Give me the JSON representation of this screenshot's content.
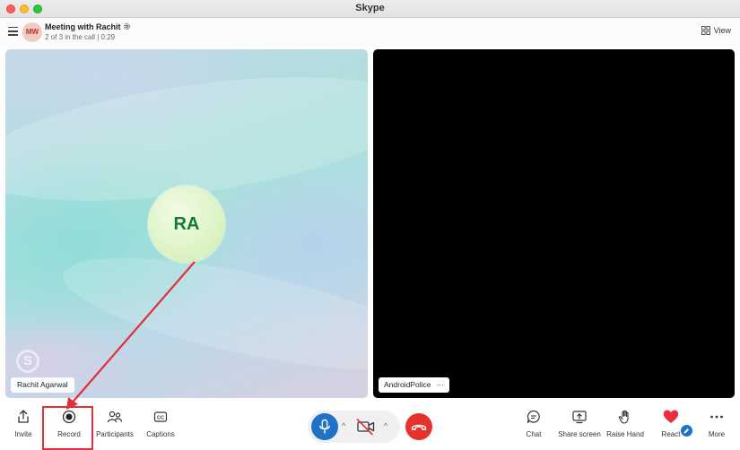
{
  "window": {
    "title": "Skype"
  },
  "header": {
    "avatar_initials": "MW",
    "meeting_title": "Meeting with Rachit",
    "call_status": "2 of 3 in the call | 0:29",
    "view_label": "View"
  },
  "tiles": {
    "left": {
      "initials": "RA",
      "name": "Rachit Agarwal"
    },
    "right": {
      "name": "AndroidPolice",
      "more": "···"
    }
  },
  "toolbar": {
    "invite": "Invite",
    "record": "Record",
    "participants": "Participants",
    "captions": "Captions",
    "chat": "Chat",
    "share_screen": "Share screen",
    "raise_hand": "Raise Hand",
    "react": "React",
    "more": "More"
  },
  "colors": {
    "accent_blue": "#1e72c8",
    "hangup_red": "#e5322d",
    "annotation_red": "#e0303a",
    "react_heart": "#e8303a"
  },
  "icons": {
    "menu": "hamburger-icon",
    "settings": "gear-icon",
    "view": "grid-icon",
    "invite": "share-up-icon",
    "record": "record-icon",
    "participants": "people-icon",
    "captions": "cc-icon",
    "mic": "microphone-icon",
    "camera": "camera-off-icon",
    "hangup": "phone-hangup-icon",
    "chat": "chat-bubble-icon",
    "share_screen": "share-screen-icon",
    "raise_hand": "hand-icon",
    "react": "heart-icon",
    "more": "ellipsis-icon"
  }
}
